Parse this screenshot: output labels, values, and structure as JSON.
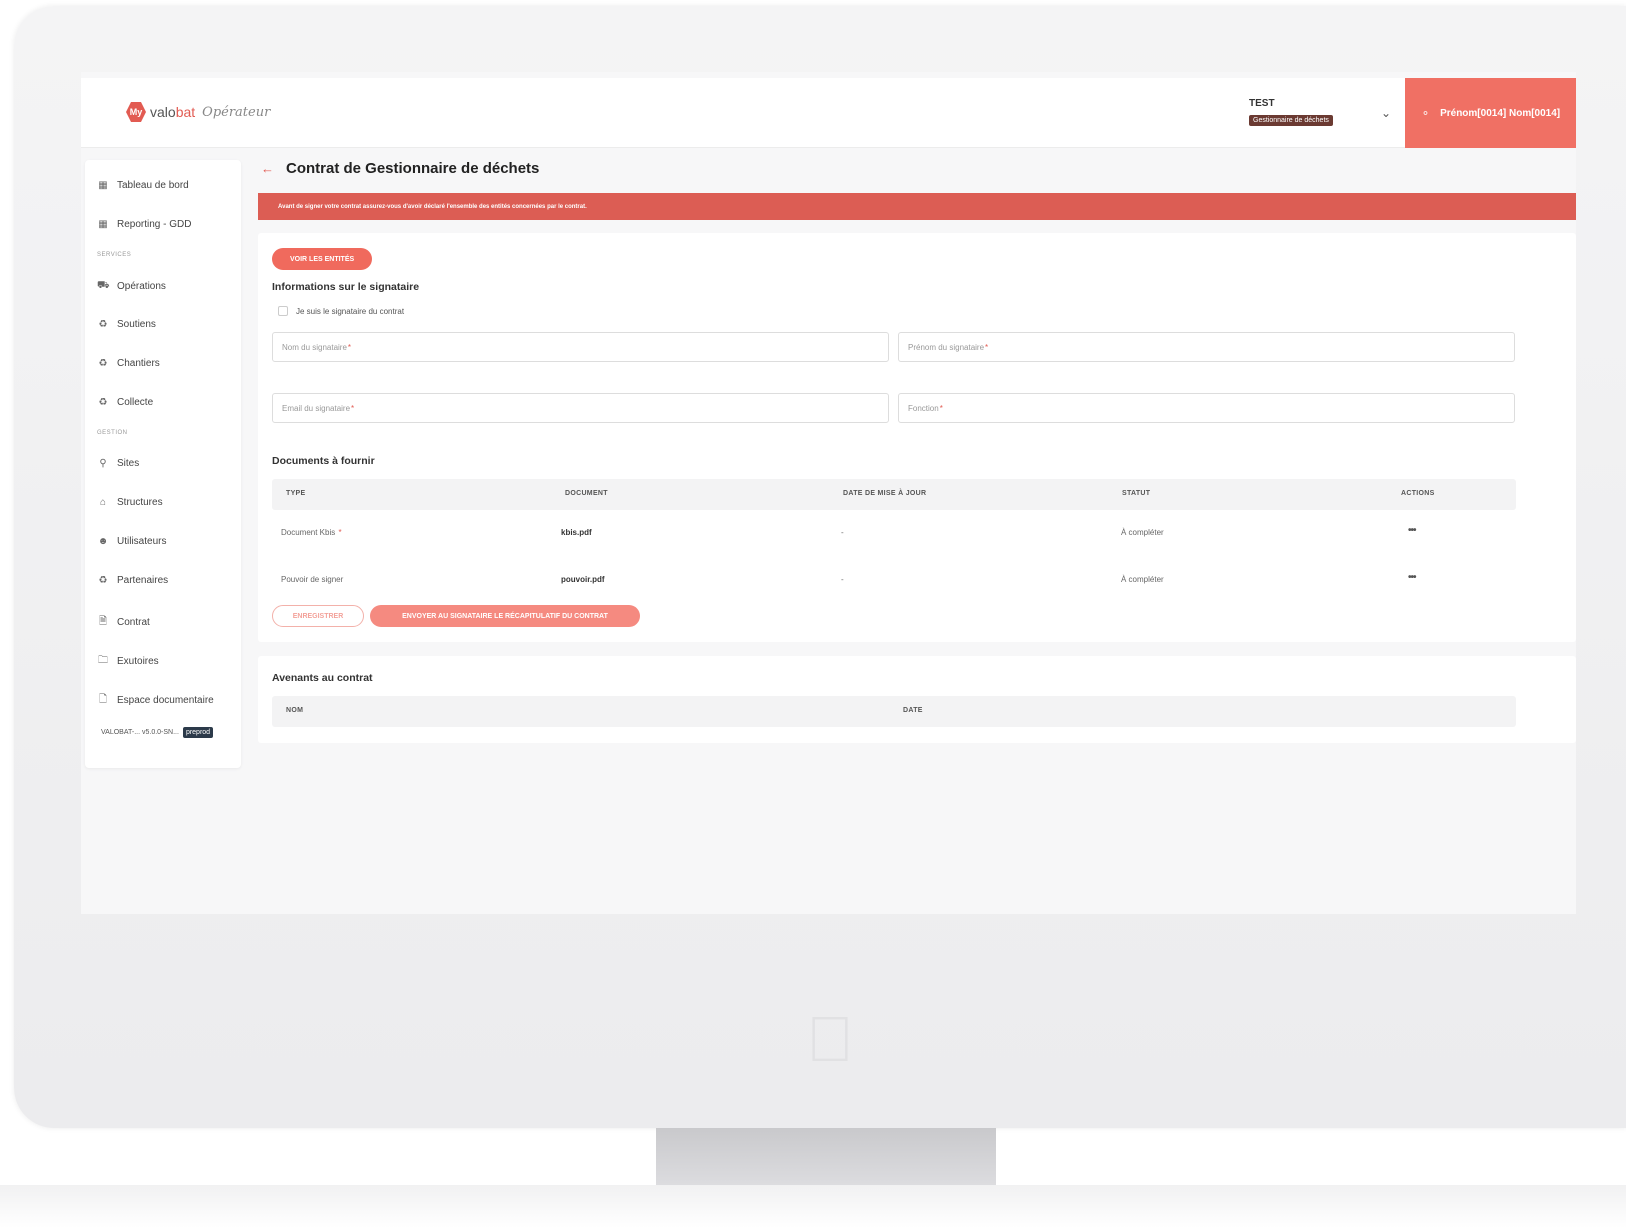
{
  "header": {
    "logo_badge": "My",
    "logo_name_a": "valo",
    "logo_name_b": "bat",
    "logo_tagline": "Opérateur",
    "company_name": "TEST",
    "company_role": "Gestionnaire de déchets",
    "user_name": "Prénom[0014] Nom[0014]"
  },
  "sidebar": {
    "items_top": [
      {
        "label": "Tableau de bord",
        "icon": "dashboard-icon"
      },
      {
        "label": "Reporting - GDD",
        "icon": "dashboard-icon"
      }
    ],
    "section_services": "SERVICES",
    "items_services": [
      {
        "label": "Opérations",
        "icon": "truck-icon"
      },
      {
        "label": "Soutiens",
        "icon": "recycle-icon"
      },
      {
        "label": "Chantiers",
        "icon": "recycle-icon"
      },
      {
        "label": "Collecte",
        "icon": "recycle-icon"
      }
    ],
    "section_gestion": "GESTION",
    "items_gestion": [
      {
        "label": "Sites",
        "icon": "location-pin-icon"
      },
      {
        "label": "Structures",
        "icon": "building-icon"
      },
      {
        "label": "Utilisateurs",
        "icon": "users-icon"
      },
      {
        "label": "Partenaires",
        "icon": "recycle-icon"
      },
      {
        "label": "Contrat",
        "icon": "contract-icon"
      },
      {
        "label": "Exutoires",
        "icon": "folder-icon"
      },
      {
        "label": "Espace documentaire",
        "icon": "document-icon"
      }
    ],
    "version_text": "VALOBAT-... v5.0.0-SN...",
    "env_badge": "preprod"
  },
  "main": {
    "title": "Contrat de Gestionnaire de déchets",
    "alert": "Avant de signer votre contrat assurez-vous d'avoir déclaré l'ensemble des entités concernées par le contrat.",
    "btn_entities": "VOIR LES ENTITÉS",
    "signer_section": "Informations sur le signataire",
    "checkbox_label": "Je suis le signataire du contrat",
    "fields": {
      "nom": "Nom du signataire",
      "prenom": "Prénom du signataire",
      "email": "Email du signataire",
      "fonction": "Fonction"
    },
    "docs_section": "Documents à fournir",
    "columns": [
      "TYPE",
      "DOCUMENT",
      "DATE DE MISE À JOUR",
      "STATUT",
      "ACTIONS"
    ],
    "rows": [
      {
        "type": "Document Kbis",
        "required": true,
        "document": "kbis.pdf",
        "date": "-",
        "status": "À compléter"
      },
      {
        "type": "Pouvoir de signer",
        "required": false,
        "document": "pouvoir.pdf",
        "date": "-",
        "status": "À compléter"
      }
    ],
    "actions_glyph": "•••",
    "btn_save": "ENREGISTRER",
    "btn_send": "ENVOYER AU SIGNATAIRE LE RÉCAPITULATIF DU CONTRAT",
    "amendments_section": "Avenants au contrat",
    "amend_columns": [
      "NOM",
      "DATE"
    ]
  },
  "colors": {
    "accent": "#e25b52",
    "alert_bg": "#dc5d54",
    "user_btn": "#f07064",
    "badge_dark": "#6b3a32"
  }
}
